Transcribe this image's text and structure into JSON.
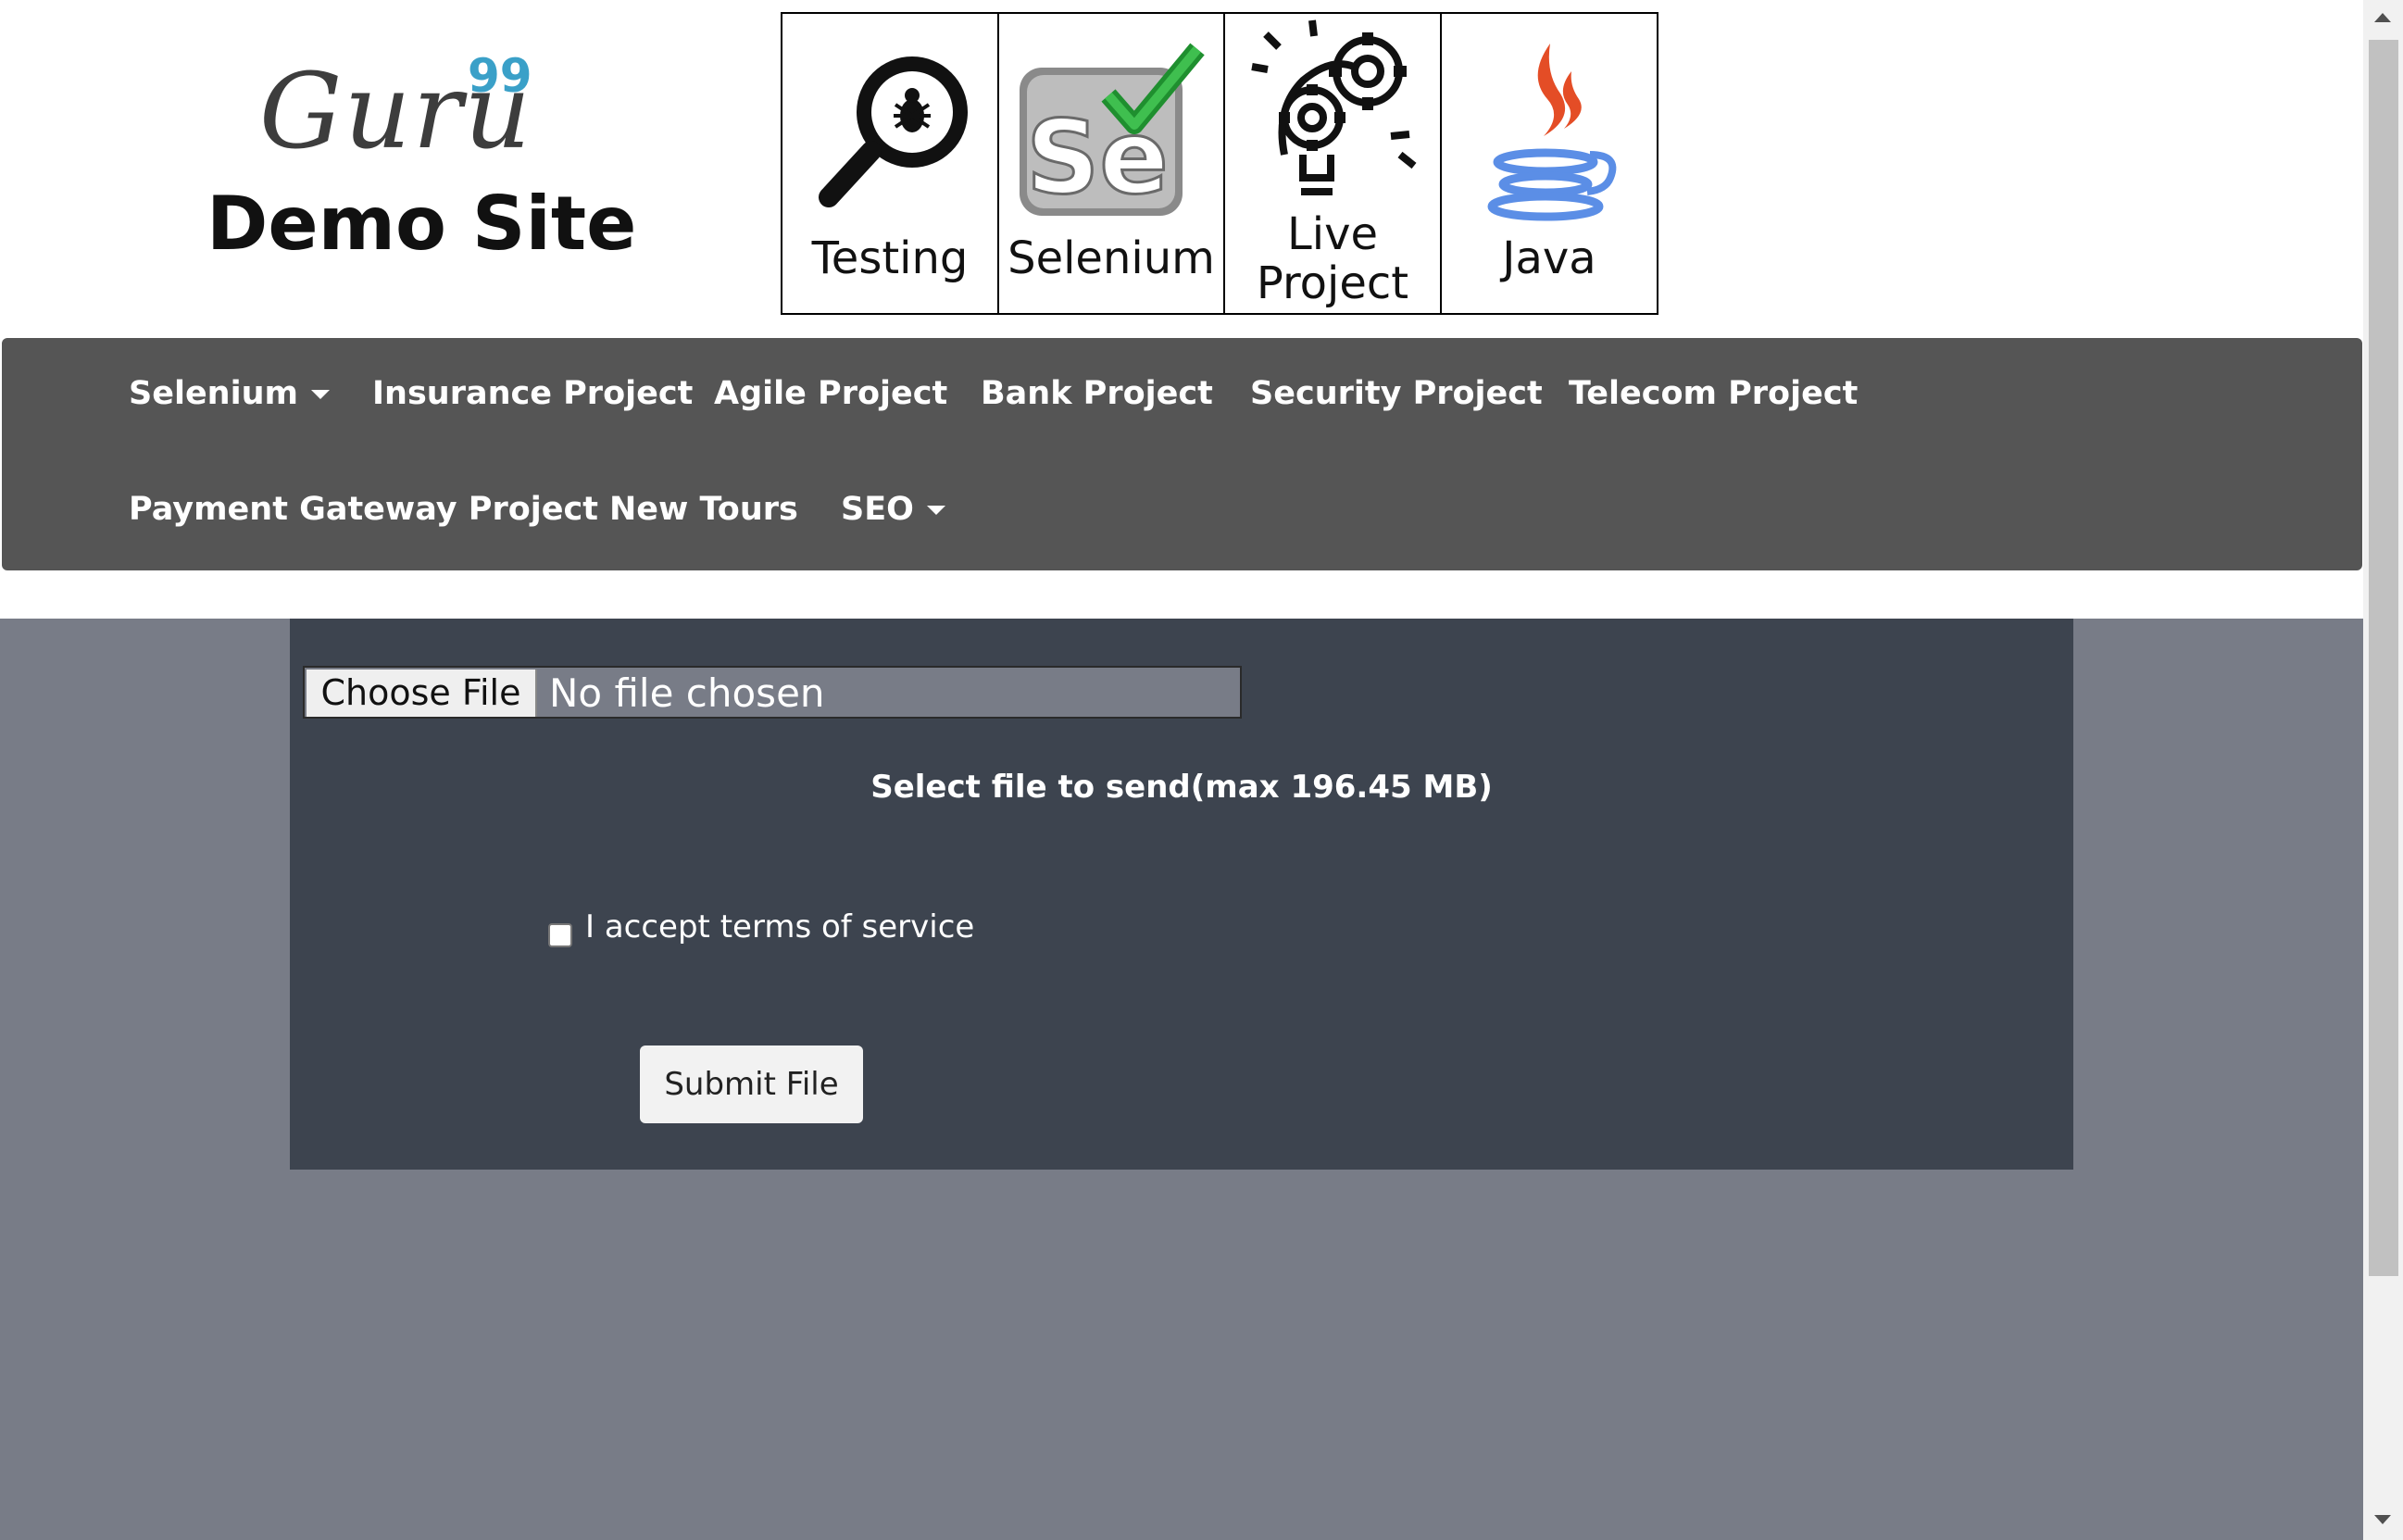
{
  "header": {
    "logo_brand": "Guru",
    "logo_superscript": "99",
    "logo_subtitle": "Demo Site",
    "tiles": [
      {
        "label": "Testing",
        "icon": "magnifier-bug-icon"
      },
      {
        "label": "Selenium",
        "icon": "selenium-logo-icon"
      },
      {
        "label_line1": "Live",
        "label_line2": "Project",
        "icon": "lightbulb-gears-icon"
      },
      {
        "label": "Java",
        "icon": "java-logo-icon"
      }
    ]
  },
  "nav": {
    "row1": [
      "Selenium",
      "Insurance Project",
      "Agile Project",
      "Bank Project",
      "Security Project",
      "Telecom Project"
    ],
    "row2": [
      "Payment Gateway Project",
      "New Tours",
      "SEO"
    ]
  },
  "upload": {
    "choose_file_label": "Choose File",
    "file_status": "No file chosen",
    "hint": "Select file to send(max 196.45 MB)",
    "terms_label": "I accept terms of service",
    "terms_checked": false,
    "submit_label": "Submit File"
  },
  "colors": {
    "nav_bg": "#555555",
    "panel_bg": "#3d444f",
    "page_bg": "#787c87",
    "logo_accent": "#3aa0c8"
  }
}
